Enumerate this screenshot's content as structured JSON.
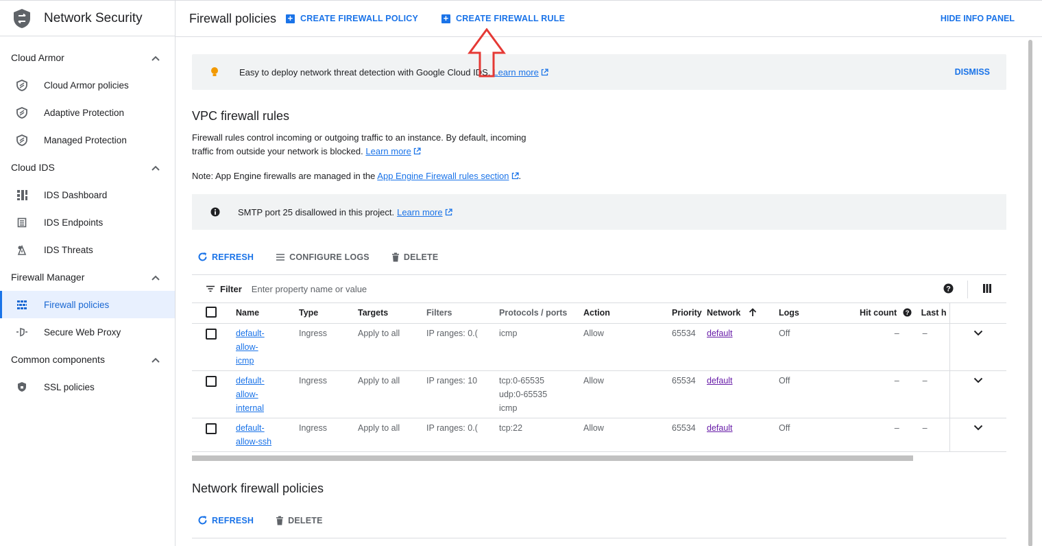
{
  "sidebar": {
    "product_title": "Network Security",
    "sections": [
      {
        "label": "Cloud Armor",
        "items": [
          {
            "label": "Cloud Armor policies",
            "icon": "shield-icon"
          },
          {
            "label": "Adaptive Protection",
            "icon": "shield-icon"
          },
          {
            "label": "Managed Protection",
            "icon": "shield-icon"
          }
        ]
      },
      {
        "label": "Cloud IDS",
        "items": [
          {
            "label": "IDS Dashboard",
            "icon": "dashboard-icon"
          },
          {
            "label": "IDS Endpoints",
            "icon": "endpoint-icon"
          },
          {
            "label": "IDS Threats",
            "icon": "threat-icon"
          }
        ]
      },
      {
        "label": "Firewall Manager",
        "items": [
          {
            "label": "Firewall policies",
            "icon": "firewall-icon",
            "active": true
          },
          {
            "label": "Secure Web Proxy",
            "icon": "proxy-icon"
          }
        ]
      },
      {
        "label": "Common components",
        "items": [
          {
            "label": "SSL policies",
            "icon": "lock-shield-icon"
          }
        ]
      }
    ]
  },
  "header": {
    "title": "Firewall policies",
    "create_policy": "CREATE FIREWALL POLICY",
    "create_rule": "CREATE FIREWALL RULE",
    "hide_info": "HIDE INFO PANEL"
  },
  "banner": {
    "text": "Easy to deploy network threat detection with Google Cloud IDS.",
    "link": "Learn more",
    "dismiss": "DISMISS"
  },
  "vpc": {
    "title": "VPC firewall rules",
    "desc1": "Firewall rules control incoming or outgoing traffic to an instance. By default, incoming",
    "desc2": "traffic from outside your network is blocked.",
    "desc_link": "Learn more",
    "note_prefix": "Note: App Engine firewalls are managed in the",
    "note_link": "App Engine Firewall rules section",
    "note_suffix": ".",
    "smtp_text": "SMTP port 25 disallowed in this project.",
    "smtp_link": "Learn more",
    "actions": {
      "refresh": "REFRESH",
      "configure_logs": "CONFIGURE LOGS",
      "delete": "DELETE"
    },
    "filter_label": "Filter",
    "filter_placeholder": "Enter property name or value",
    "columns": [
      "Name",
      "Type",
      "Targets",
      "Filters",
      "Protocols / ports",
      "Action",
      "Priority",
      "Network",
      "Logs",
      "Hit count",
      "Last h"
    ],
    "rows": [
      {
        "name": [
          "default-",
          "allow-",
          "icmp"
        ],
        "type": "Ingress",
        "targets": "Apply to all",
        "filters": "IP ranges: 0.(",
        "protocols": [
          "icmp"
        ],
        "action": "Allow",
        "priority": "65534",
        "network": "default",
        "logs": "Off",
        "hit_count": "–",
        "last_hit": "–"
      },
      {
        "name": [
          "default-",
          "allow-",
          "internal"
        ],
        "type": "Ingress",
        "targets": "Apply to all",
        "filters": "IP ranges: 10",
        "protocols": [
          "tcp:0-65535",
          "udp:0-65535",
          "icmp"
        ],
        "action": "Allow",
        "priority": "65534",
        "network": "default",
        "logs": "Off",
        "hit_count": "–",
        "last_hit": "–"
      },
      {
        "name": [
          "default-",
          "allow-ssh"
        ],
        "type": "Ingress",
        "targets": "Apply to all",
        "filters": "IP ranges: 0.(",
        "protocols": [
          "tcp:22"
        ],
        "action": "Allow",
        "priority": "65534",
        "network": "default",
        "logs": "Off",
        "hit_count": "–",
        "last_hit": "–"
      }
    ]
  },
  "nfp": {
    "title": "Network firewall policies",
    "actions": {
      "refresh": "REFRESH",
      "delete": "DELETE"
    }
  },
  "colors": {
    "accent": "#1a73e8",
    "annotation_arrow": "#e53935",
    "visited_link": "#681da8"
  }
}
